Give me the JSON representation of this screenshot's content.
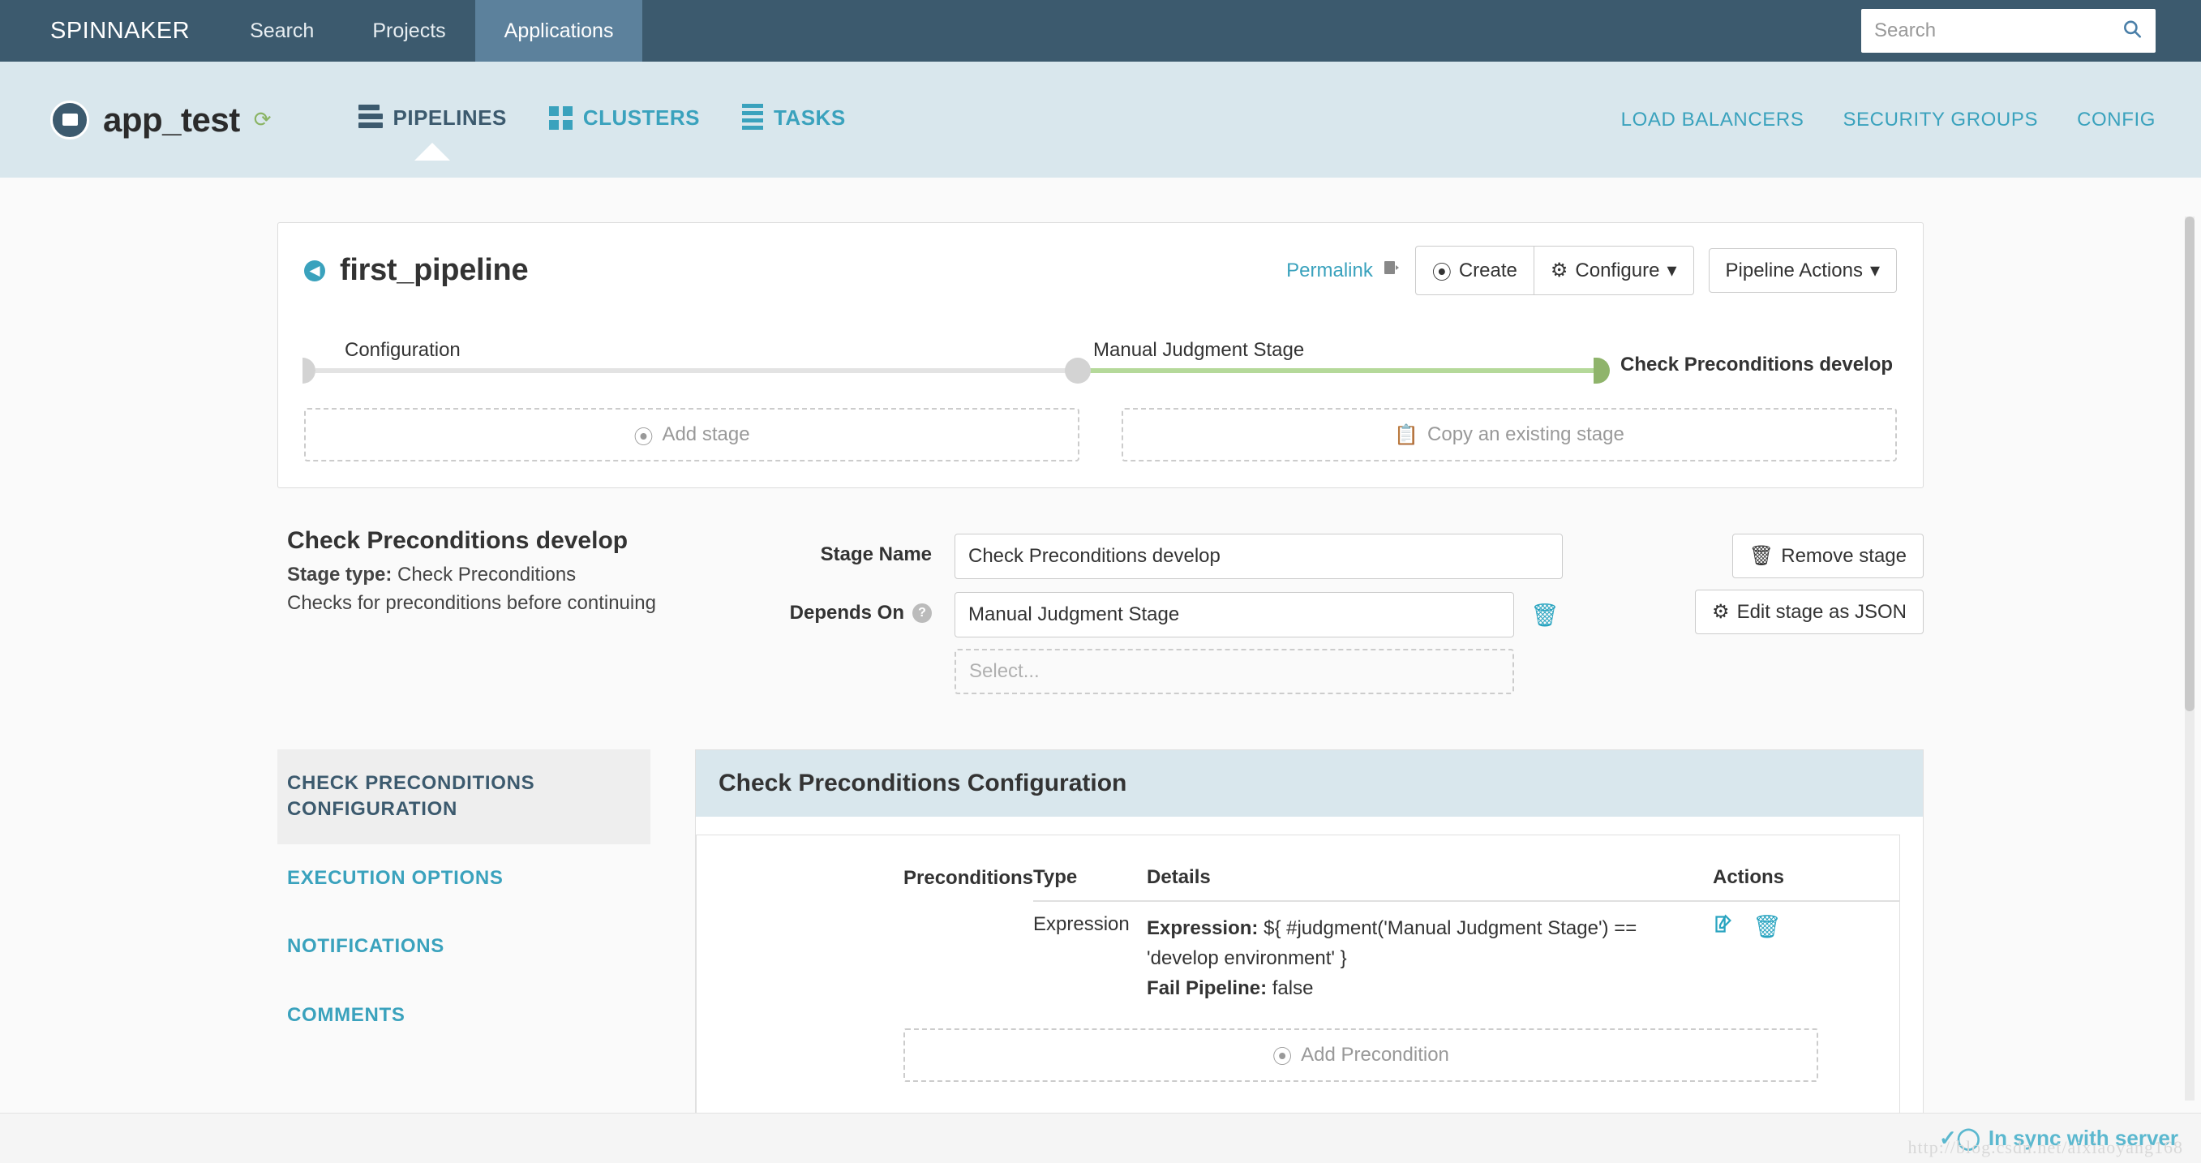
{
  "topnav": {
    "brand": "SPINNAKER",
    "items": [
      {
        "label": "Search",
        "active": false
      },
      {
        "label": "Projects",
        "active": false
      },
      {
        "label": "Applications",
        "active": true
      }
    ],
    "search": {
      "placeholder": "Search",
      "value": "",
      "icon": "search-icon"
    }
  },
  "appheader": {
    "app_name": "app_test",
    "refresh_icon": "refresh-icon",
    "tabs": [
      {
        "label": "PIPELINES",
        "icon": "pipelines-icon",
        "active": true
      },
      {
        "label": "CLUSTERS",
        "icon": "clusters-icon",
        "active": false
      },
      {
        "label": "TASKS",
        "icon": "tasks-icon",
        "active": false
      }
    ],
    "links": [
      {
        "label": "LOAD BALANCERS"
      },
      {
        "label": "SECURITY GROUPS"
      },
      {
        "label": "CONFIG"
      }
    ]
  },
  "pipeline": {
    "title": "first_pipeline",
    "permalink_label": "Permalink",
    "permalink_icon": "permalink-icon",
    "buttons": {
      "create": "Create",
      "configure": "Configure",
      "pipeline_actions": "Pipeline Actions"
    },
    "stages": [
      {
        "label": "Configuration",
        "state": "default"
      },
      {
        "label": "Manual Judgment Stage",
        "state": "default"
      },
      {
        "label": "Check Preconditions develop",
        "state": "selected"
      }
    ],
    "add_stage": "Add stage",
    "copy_stage": "Copy an existing stage"
  },
  "stage_details": {
    "title": "Check Preconditions develop",
    "stage_type_label": "Stage type:",
    "stage_type_value": "Check Preconditions",
    "description": "Checks for preconditions before continuing",
    "form": {
      "stage_name_label": "Stage Name",
      "stage_name_value": "Check Preconditions develop",
      "depends_on_label": "Depends On",
      "depends_on_value": "Manual Judgment Stage",
      "depends_on_delete_icon": "trash-icon",
      "select_placeholder": "Select..."
    },
    "actions": {
      "remove_stage": "Remove stage",
      "edit_json": "Edit stage as JSON"
    }
  },
  "side_menu": {
    "items": [
      {
        "label": "CHECK PRECONDITIONS CONFIGURATION",
        "active": true
      },
      {
        "label": "EXECUTION OPTIONS",
        "active": false
      },
      {
        "label": "NOTIFICATIONS",
        "active": false
      },
      {
        "label": "COMMENTS",
        "active": false
      }
    ]
  },
  "config_panel": {
    "title": "Check Preconditions Configuration",
    "table": {
      "headers": [
        "Preconditions",
        "Type",
        "Details",
        "Actions"
      ],
      "rows": [
        {
          "preconditions": "",
          "type": "Expression",
          "details_label_1": "Expression:",
          "details_value_1": "${ #judgment('Manual Judgment Stage') == 'develop environment' }",
          "details_label_2": "Fail Pipeline:",
          "details_value_2": "false",
          "edit_icon": "edit-icon",
          "delete_icon": "trash-icon"
        }
      ]
    },
    "add_precondition": "Add Precondition"
  },
  "footer": {
    "sync_status": "In sync with server",
    "sync_icon": "check-circle-icon",
    "watermark": "http://blog.csdn.net/aixiaoyang168"
  }
}
